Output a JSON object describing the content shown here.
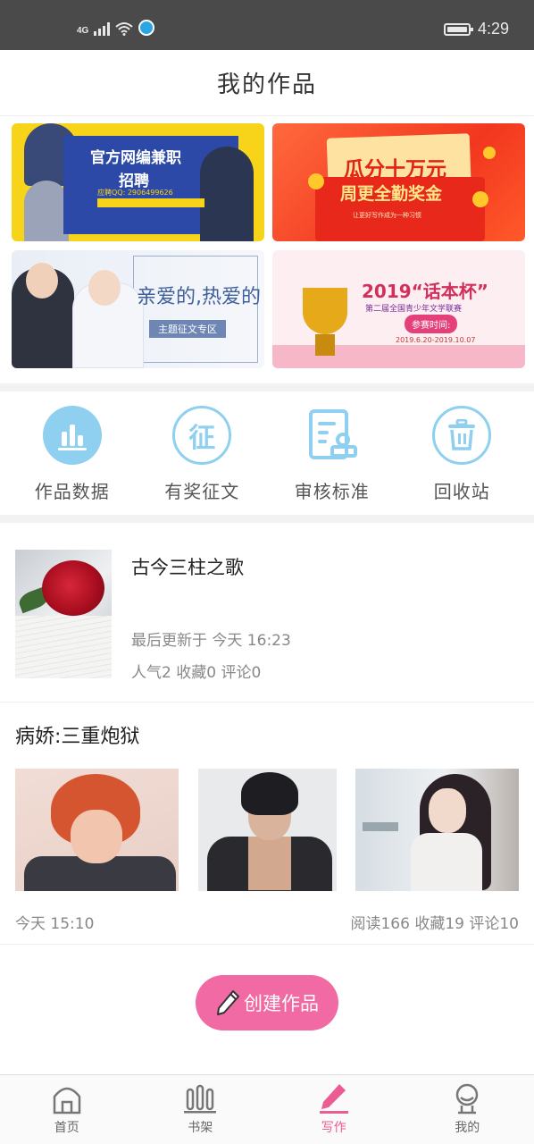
{
  "status_bar": {
    "network": "4G",
    "time": "4:29"
  },
  "header": {
    "title": "我的作品"
  },
  "banners": [
    {
      "title": "官方网编兼职",
      "subtitle": "招聘",
      "detail": "应聘QQ: 2906499626"
    },
    {
      "title": "瓜分十万元",
      "subtitle": "周更全勤奖金",
      "detail": "让更好写作成为一种习惯"
    },
    {
      "title": "亲爱的,热爱的",
      "tag": "主题征文专区"
    },
    {
      "title": "2019“话本杯”",
      "subtitle": "第二届全国青少年文学联赛",
      "button": "参赛时间:",
      "dates": "2019.6.20-2019.10.07"
    }
  ],
  "quick_actions": [
    {
      "label": "作品数据",
      "icon": "bar-chart-icon"
    },
    {
      "label": "有奖征文",
      "icon": "contest-icon",
      "glyph": "征"
    },
    {
      "label": "审核标准",
      "icon": "review-doc-icon"
    },
    {
      "label": "回收站",
      "icon": "trash-icon"
    }
  ],
  "works": [
    {
      "title": "古今三柱之歌",
      "updated": "最后更新于 今天 16:23",
      "stats": "人气2 收藏0 评论0"
    },
    {
      "title": "病娇:三重炮狱",
      "time": "今天 15:10",
      "stats": "阅读166 收藏19 评论10"
    }
  ],
  "create_button": {
    "label": "创建作品"
  },
  "tabbar": [
    {
      "label": "首页",
      "icon": "home-icon"
    },
    {
      "label": "书架",
      "icon": "bookshelf-icon"
    },
    {
      "label": "写作",
      "icon": "pen-icon",
      "active": true
    },
    {
      "label": "我的",
      "icon": "profile-icon"
    }
  ],
  "colors": {
    "accent": "#ec5b94",
    "icon_blue": "#8fcfef",
    "status_bar": "#4a4a4a"
  }
}
